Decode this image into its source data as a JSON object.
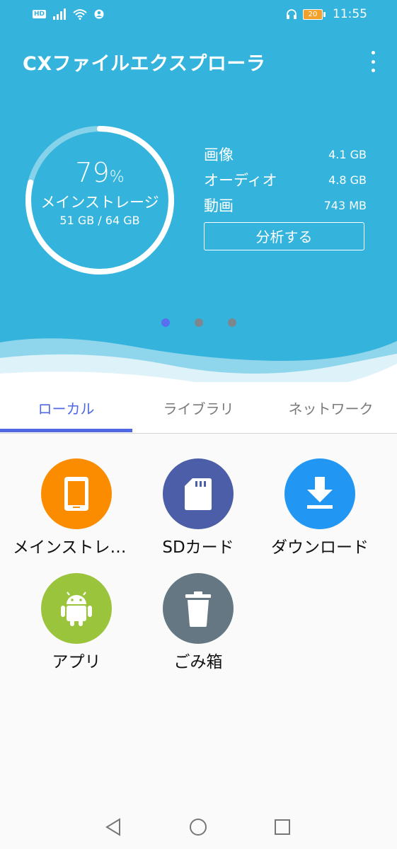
{
  "status_bar": {
    "badge": "HD",
    "time": "11:55",
    "battery": "20"
  },
  "app_title": "CXファイルエクスプローラ",
  "storage": {
    "percent": "79",
    "percent_unit": "%",
    "percent_value": 0.79,
    "name": "メインストレージ",
    "usage": "51 GB / 64 GB",
    "stats": [
      {
        "label": "画像",
        "value": "4.1 GB"
      },
      {
        "label": "オーディオ",
        "value": "4.8 GB"
      },
      {
        "label": "動画",
        "value": "743 MB"
      }
    ],
    "analyze_label": "分析する"
  },
  "pager": {
    "count": 3,
    "active": 1
  },
  "tabs": [
    {
      "label": "ローカル",
      "active": true
    },
    {
      "label": "ライブラリ",
      "active": false
    },
    {
      "label": "ネットワーク",
      "active": false
    }
  ],
  "locations": [
    {
      "label": "メインストレージ",
      "icon": "tablet-icon",
      "color": "#fb8c00"
    },
    {
      "label": "SDカード",
      "icon": "sd-card-icon",
      "color": "#4c5ea8"
    },
    {
      "label": "ダウンロード",
      "icon": "download-icon",
      "color": "#2196f3"
    },
    {
      "label": "アプリ",
      "icon": "android-icon",
      "color": "#9ac43b"
    },
    {
      "label": "ごみ箱",
      "icon": "trash-icon",
      "color": "#657782"
    }
  ],
  "colors": {
    "header": "#34b4dc",
    "accent": "#5067e2"
  }
}
